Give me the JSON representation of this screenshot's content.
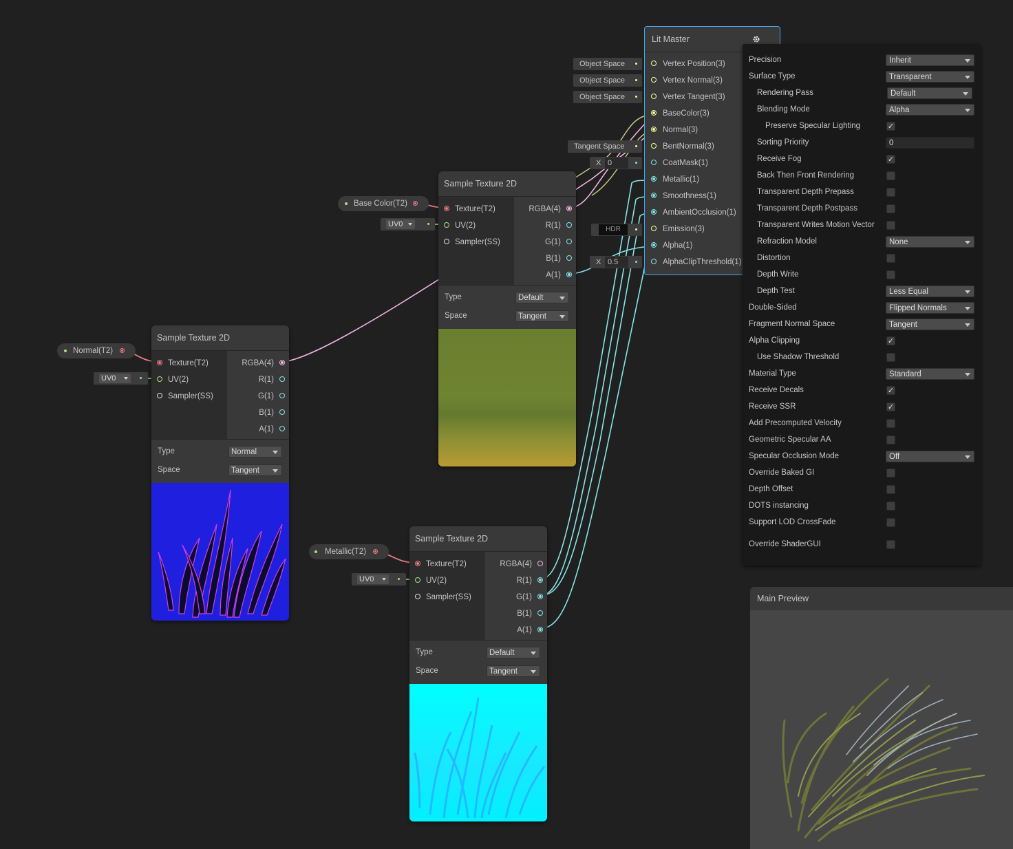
{
  "colors": {
    "background": "#202020",
    "node": "#393939",
    "texture_port": "#e97b83",
    "uv_port": "#a6e47e",
    "vector4_port": "#f3b6e1",
    "vector1_port": "#84e4e7",
    "vector3_port": "#f6ff9a",
    "master_selection": "#45a4e8"
  },
  "properties": {
    "base_color": "Base Color(T2)",
    "normal": "Normal(T2)",
    "metallic": "Metallic(T2)"
  },
  "uv_select": "UV0",
  "sample_nodes": [
    {
      "title": "Sample Texture 2D",
      "inputs": [
        "Texture(T2)",
        "UV(2)",
        "Sampler(SS)"
      ],
      "outputs": [
        "RGBA(4)",
        "R(1)",
        "G(1)",
        "B(1)",
        "A(1)"
      ],
      "type_label": "Type",
      "type_value": "Default",
      "space_label": "Space",
      "space_value": "Tangent",
      "preview": "albedo-green-grass"
    },
    {
      "title": "Sample Texture 2D",
      "inputs": [
        "Texture(T2)",
        "UV(2)",
        "Sampler(SS)"
      ],
      "outputs": [
        "RGBA(4)",
        "R(1)",
        "G(1)",
        "B(1)",
        "A(1)"
      ],
      "type_label": "Type",
      "type_value": "Normal",
      "space_label": "Space",
      "space_value": "Tangent",
      "preview": "normal-map-grass"
    },
    {
      "title": "Sample Texture 2D",
      "inputs": [
        "Texture(T2)",
        "UV(2)",
        "Sampler(SS)"
      ],
      "outputs": [
        "RGBA(4)",
        "R(1)",
        "G(1)",
        "B(1)",
        "A(1)"
      ],
      "type_label": "Type",
      "type_value": "Default",
      "space_label": "Space",
      "space_value": "Tangent",
      "preview": "mask-map-grass"
    }
  ],
  "master": {
    "title": "Lit Master",
    "gear_icon": "gear-icon",
    "ports": [
      "Vertex Position(3)",
      "Vertex Normal(3)",
      "Vertex Tangent(3)",
      "BaseColor(3)",
      "Normal(3)",
      "BentNormal(3)",
      "CoatMask(1)",
      "Metallic(1)",
      "Smoothness(1)",
      "AmbientOcclusion(1)",
      "Emission(3)",
      "Alpha(1)",
      "AlphaClipThreshold(1)"
    ],
    "inline_inputs": {
      "object_space": "Object Space",
      "tangent_space": "Tangent Space",
      "x_label": "X",
      "coatmask_value": "0",
      "hdr_label": "HDR",
      "alphaclip_value": "0.5"
    }
  },
  "settings": [
    {
      "label": "Precision",
      "indent": 0,
      "kind": "dropdown",
      "value": "Inherit"
    },
    {
      "label": "Surface Type",
      "indent": 0,
      "kind": "dropdown",
      "value": "Transparent"
    },
    {
      "label": "Rendering Pass",
      "indent": 1,
      "kind": "dropdown",
      "value": "Default"
    },
    {
      "label": "Blending Mode",
      "indent": 1,
      "kind": "dropdown",
      "value": "Alpha"
    },
    {
      "label": "Preserve Specular Lighting",
      "indent": 2,
      "kind": "check",
      "checked": true
    },
    {
      "label": "Sorting Priority",
      "indent": 1,
      "kind": "text",
      "value": "0"
    },
    {
      "label": "Receive Fog",
      "indent": 1,
      "kind": "check",
      "checked": true
    },
    {
      "label": "Back Then Front Rendering",
      "indent": 1,
      "kind": "check",
      "checked": false
    },
    {
      "label": "Transparent Depth Prepass",
      "indent": 1,
      "kind": "check",
      "checked": false
    },
    {
      "label": "Transparent Depth Postpass",
      "indent": 1,
      "kind": "check",
      "checked": false
    },
    {
      "label": "Transparent Writes Motion Vector",
      "indent": 1,
      "kind": "check",
      "checked": false
    },
    {
      "label": "Refraction Model",
      "indent": 1,
      "kind": "dropdown",
      "value": "None"
    },
    {
      "label": "Distortion",
      "indent": 1,
      "kind": "check",
      "checked": false
    },
    {
      "label": "Depth Write",
      "indent": 1,
      "kind": "check",
      "checked": false
    },
    {
      "label": "Depth Test",
      "indent": 1,
      "kind": "dropdown",
      "value": "Less Equal"
    },
    {
      "label": "Double-Sided",
      "indent": 0,
      "kind": "dropdown",
      "value": "Flipped Normals"
    },
    {
      "label": "Fragment Normal Space",
      "indent": 0,
      "kind": "dropdown",
      "value": "Tangent"
    },
    {
      "label": "Alpha Clipping",
      "indent": 0,
      "kind": "check",
      "checked": true
    },
    {
      "label": "Use Shadow Threshold",
      "indent": 1,
      "kind": "check",
      "checked": false
    },
    {
      "label": "Material Type",
      "indent": 0,
      "kind": "dropdown",
      "value": "Standard"
    },
    {
      "label": "Receive Decals",
      "indent": 0,
      "kind": "check",
      "checked": true
    },
    {
      "label": "Receive SSR",
      "indent": 0,
      "kind": "check",
      "checked": true
    },
    {
      "label": "Add Precomputed Velocity",
      "indent": 0,
      "kind": "check",
      "checked": false
    },
    {
      "label": "Geometric Specular AA",
      "indent": 0,
      "kind": "check",
      "checked": false
    },
    {
      "label": "Specular Occlusion Mode",
      "indent": 0,
      "kind": "dropdown",
      "value": "Off"
    },
    {
      "label": "Override Baked GI",
      "indent": 0,
      "kind": "check",
      "checked": false
    },
    {
      "label": "Depth Offset",
      "indent": 0,
      "kind": "check",
      "checked": false
    },
    {
      "label": "DOTS instancing",
      "indent": 0,
      "kind": "check",
      "checked": false
    },
    {
      "label": "Support LOD CrossFade",
      "indent": 0,
      "kind": "check",
      "checked": false
    },
    {
      "label": "Override ShaderGUI",
      "indent": 0,
      "kind": "check",
      "checked": false
    }
  ],
  "main_preview": {
    "title": "Main Preview"
  }
}
